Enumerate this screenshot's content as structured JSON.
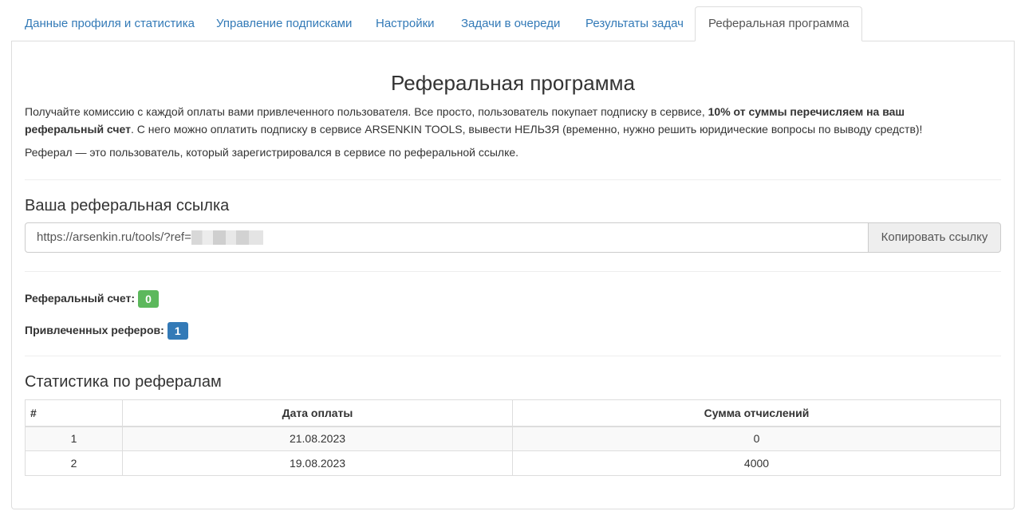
{
  "tabs": [
    {
      "label": "Данные профиля и статистика"
    },
    {
      "label": "Управление подписками"
    },
    {
      "label": "Настройки"
    },
    {
      "label": "Задачи в очереди"
    },
    {
      "label": "Результаты задач"
    },
    {
      "label": "Реферальная программа"
    }
  ],
  "active_tab_index": 5,
  "page": {
    "title": "Реферальная программа",
    "intro_part1": "Получайте комиссию с каждой оплаты вами привлеченного пользователя. Все просто, пользователь покупает подписку в сервисе, ",
    "intro_bold": "10% от суммы перечисляем на ваш реферальный счет",
    "intro_part2": ". С него можно оплатить подписку в сервисе ARSENKIN TOOLS, вывести НЕЛЬЗЯ (временно, нужно решить юридические вопросы по выводу средств)!",
    "definition": "Реферал — это пользователь, который зарегистрировался в сервисе по реферальной ссылке."
  },
  "referral_link": {
    "heading": "Ваша реферальная ссылка",
    "value_prefix": "https://arsenkin.ru/tools/?ref=",
    "copy_label": "Копировать ссылку"
  },
  "stats": {
    "account_label": "Реферальный счет:",
    "account_value": "0",
    "referrals_label": "Привлеченных реферов:",
    "referrals_value": "1"
  },
  "colors": {
    "link": "#337ab7",
    "badge_success": "#5cb85c",
    "badge_primary": "#337ab7"
  },
  "referral_table": {
    "heading": "Статистика по рефералам",
    "columns": [
      "#",
      "Дата оплаты",
      "Сумма отчислений"
    ],
    "rows": [
      [
        "1",
        "21.08.2023",
        "0"
      ],
      [
        "2",
        "19.08.2023",
        "4000"
      ]
    ]
  }
}
